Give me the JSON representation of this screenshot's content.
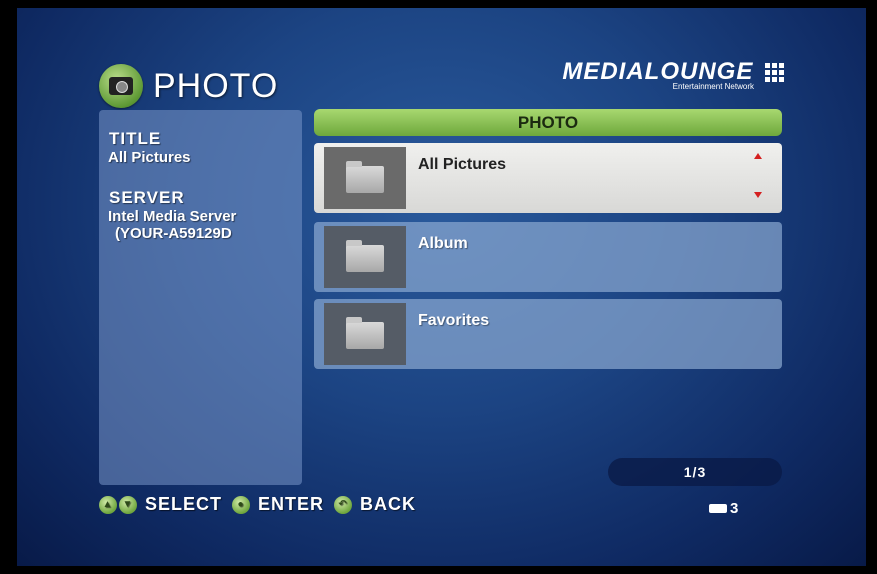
{
  "header": {
    "title": "PHOTO"
  },
  "brand": {
    "name": "MEDIALOUNGE",
    "tagline": "Entertainment Network"
  },
  "info": {
    "title_label": "TITLE",
    "title_value": "All Pictures",
    "server_label": "SERVER",
    "server_line1": "Intel Media Server",
    "server_line2": "(YOUR-A59129D"
  },
  "list": {
    "header": "PHOTO",
    "items": [
      {
        "label": "All Pictures",
        "selected": true
      },
      {
        "label": "Album",
        "selected": false
      },
      {
        "label": "Favorites",
        "selected": false
      }
    ]
  },
  "pager": {
    "text": "1/3"
  },
  "footer": {
    "select_label": "SELECT",
    "enter_label": "ENTER",
    "back_label": "BACK"
  },
  "card_count": "3",
  "colors": {
    "accent_green": "#8cc454",
    "background_blue": "#1c4483",
    "scroll_arrow_red": "#d42020"
  },
  "icons": [
    "camera-icon",
    "folder-icon",
    "up-arrow-icon",
    "down-arrow-icon",
    "memory-card-icon"
  ]
}
